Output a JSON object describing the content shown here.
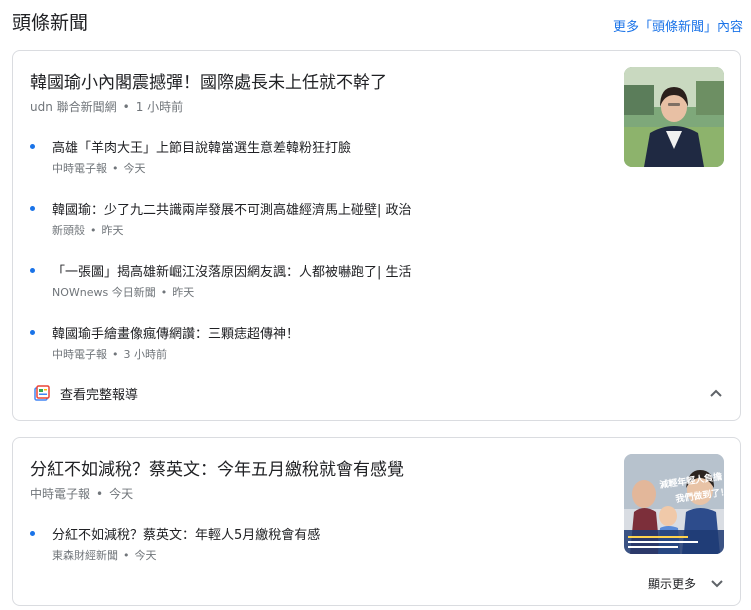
{
  "section": {
    "title": "頭條新聞",
    "more_link": "更多「頭條新聞」內容"
  },
  "card1": {
    "headline": "韓國瑜小內閣震撼彈！國際處長未上任就不幹了",
    "source": "udn 聯合新聞網",
    "time": "1 小時前",
    "items": [
      {
        "title": "高雄「羊肉大王」上節目說韓當選生意差韓粉狂打臉",
        "source": "中時電子報",
        "time": "今天"
      },
      {
        "title": "韓國瑜：少了九二共識兩岸發展不可測高雄經濟馬上碰壁| 政治",
        "source": "新頭殼",
        "time": "昨天"
      },
      {
        "title": "「一張圖」揭高雄新崛江沒落原因網友諷：人都被嚇跑了| 生活",
        "source": "NOWnews 今日新聞",
        "time": "昨天"
      },
      {
        "title": "韓國瑜手繪畫像瘋傳網讚：三顆痣超傳神！",
        "source": "中時電子報",
        "time": "3 小時前"
      }
    ],
    "full_coverage": "查看完整報導"
  },
  "card2": {
    "headline": "分紅不如減稅？蔡英文：今年五月繳稅就會有感覺",
    "source": "中時電子報",
    "time": "今天",
    "items": [
      {
        "title": "分紅不如減稅？蔡英文：年輕人5月繳稅會有感",
        "source": "東森財經新聞",
        "time": "今天"
      }
    ],
    "show_more": "顯示更多",
    "thumb_caption": "減輕年輕人負擔 我們做到了！"
  },
  "colors": {
    "link": "#1a73e8",
    "border": "#dadce0",
    "meta": "#70757a",
    "text": "#202124"
  }
}
